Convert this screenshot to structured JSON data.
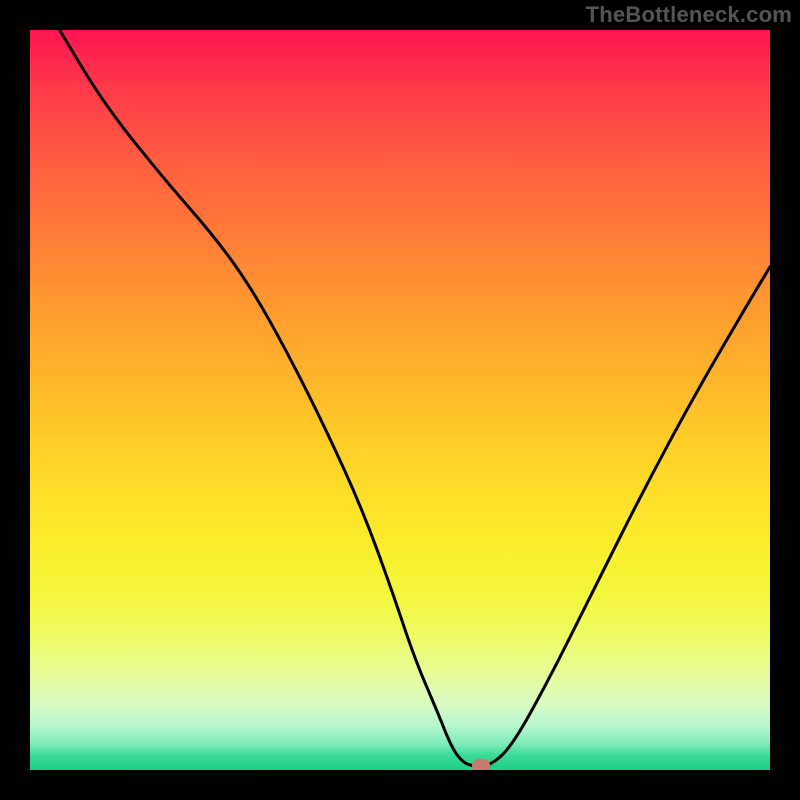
{
  "watermark": "TheBottleneck.com",
  "chart_data": {
    "type": "line",
    "title": "",
    "xlabel": "",
    "ylabel": "",
    "xlim": [
      0,
      100
    ],
    "ylim": [
      0,
      100
    ],
    "grid": false,
    "series": [
      {
        "name": "curve",
        "x": [
          4,
          10,
          18,
          25,
          30,
          35,
          40,
          45,
          49,
          52,
          55,
          57,
          58.5,
          60,
          62,
          65,
          70,
          76,
          83,
          90,
          97,
          100
        ],
        "y": [
          100,
          90,
          80,
          72,
          65,
          56,
          46,
          35,
          24,
          15,
          8,
          3,
          1,
          0.5,
          0.5,
          3,
          12,
          24,
          38,
          51,
          63,
          68
        ]
      }
    ],
    "marker": {
      "x": 61,
      "y": 0.6
    }
  },
  "colors": {
    "background": "#000000",
    "curve": "#000000",
    "marker": "#c47a6d"
  }
}
